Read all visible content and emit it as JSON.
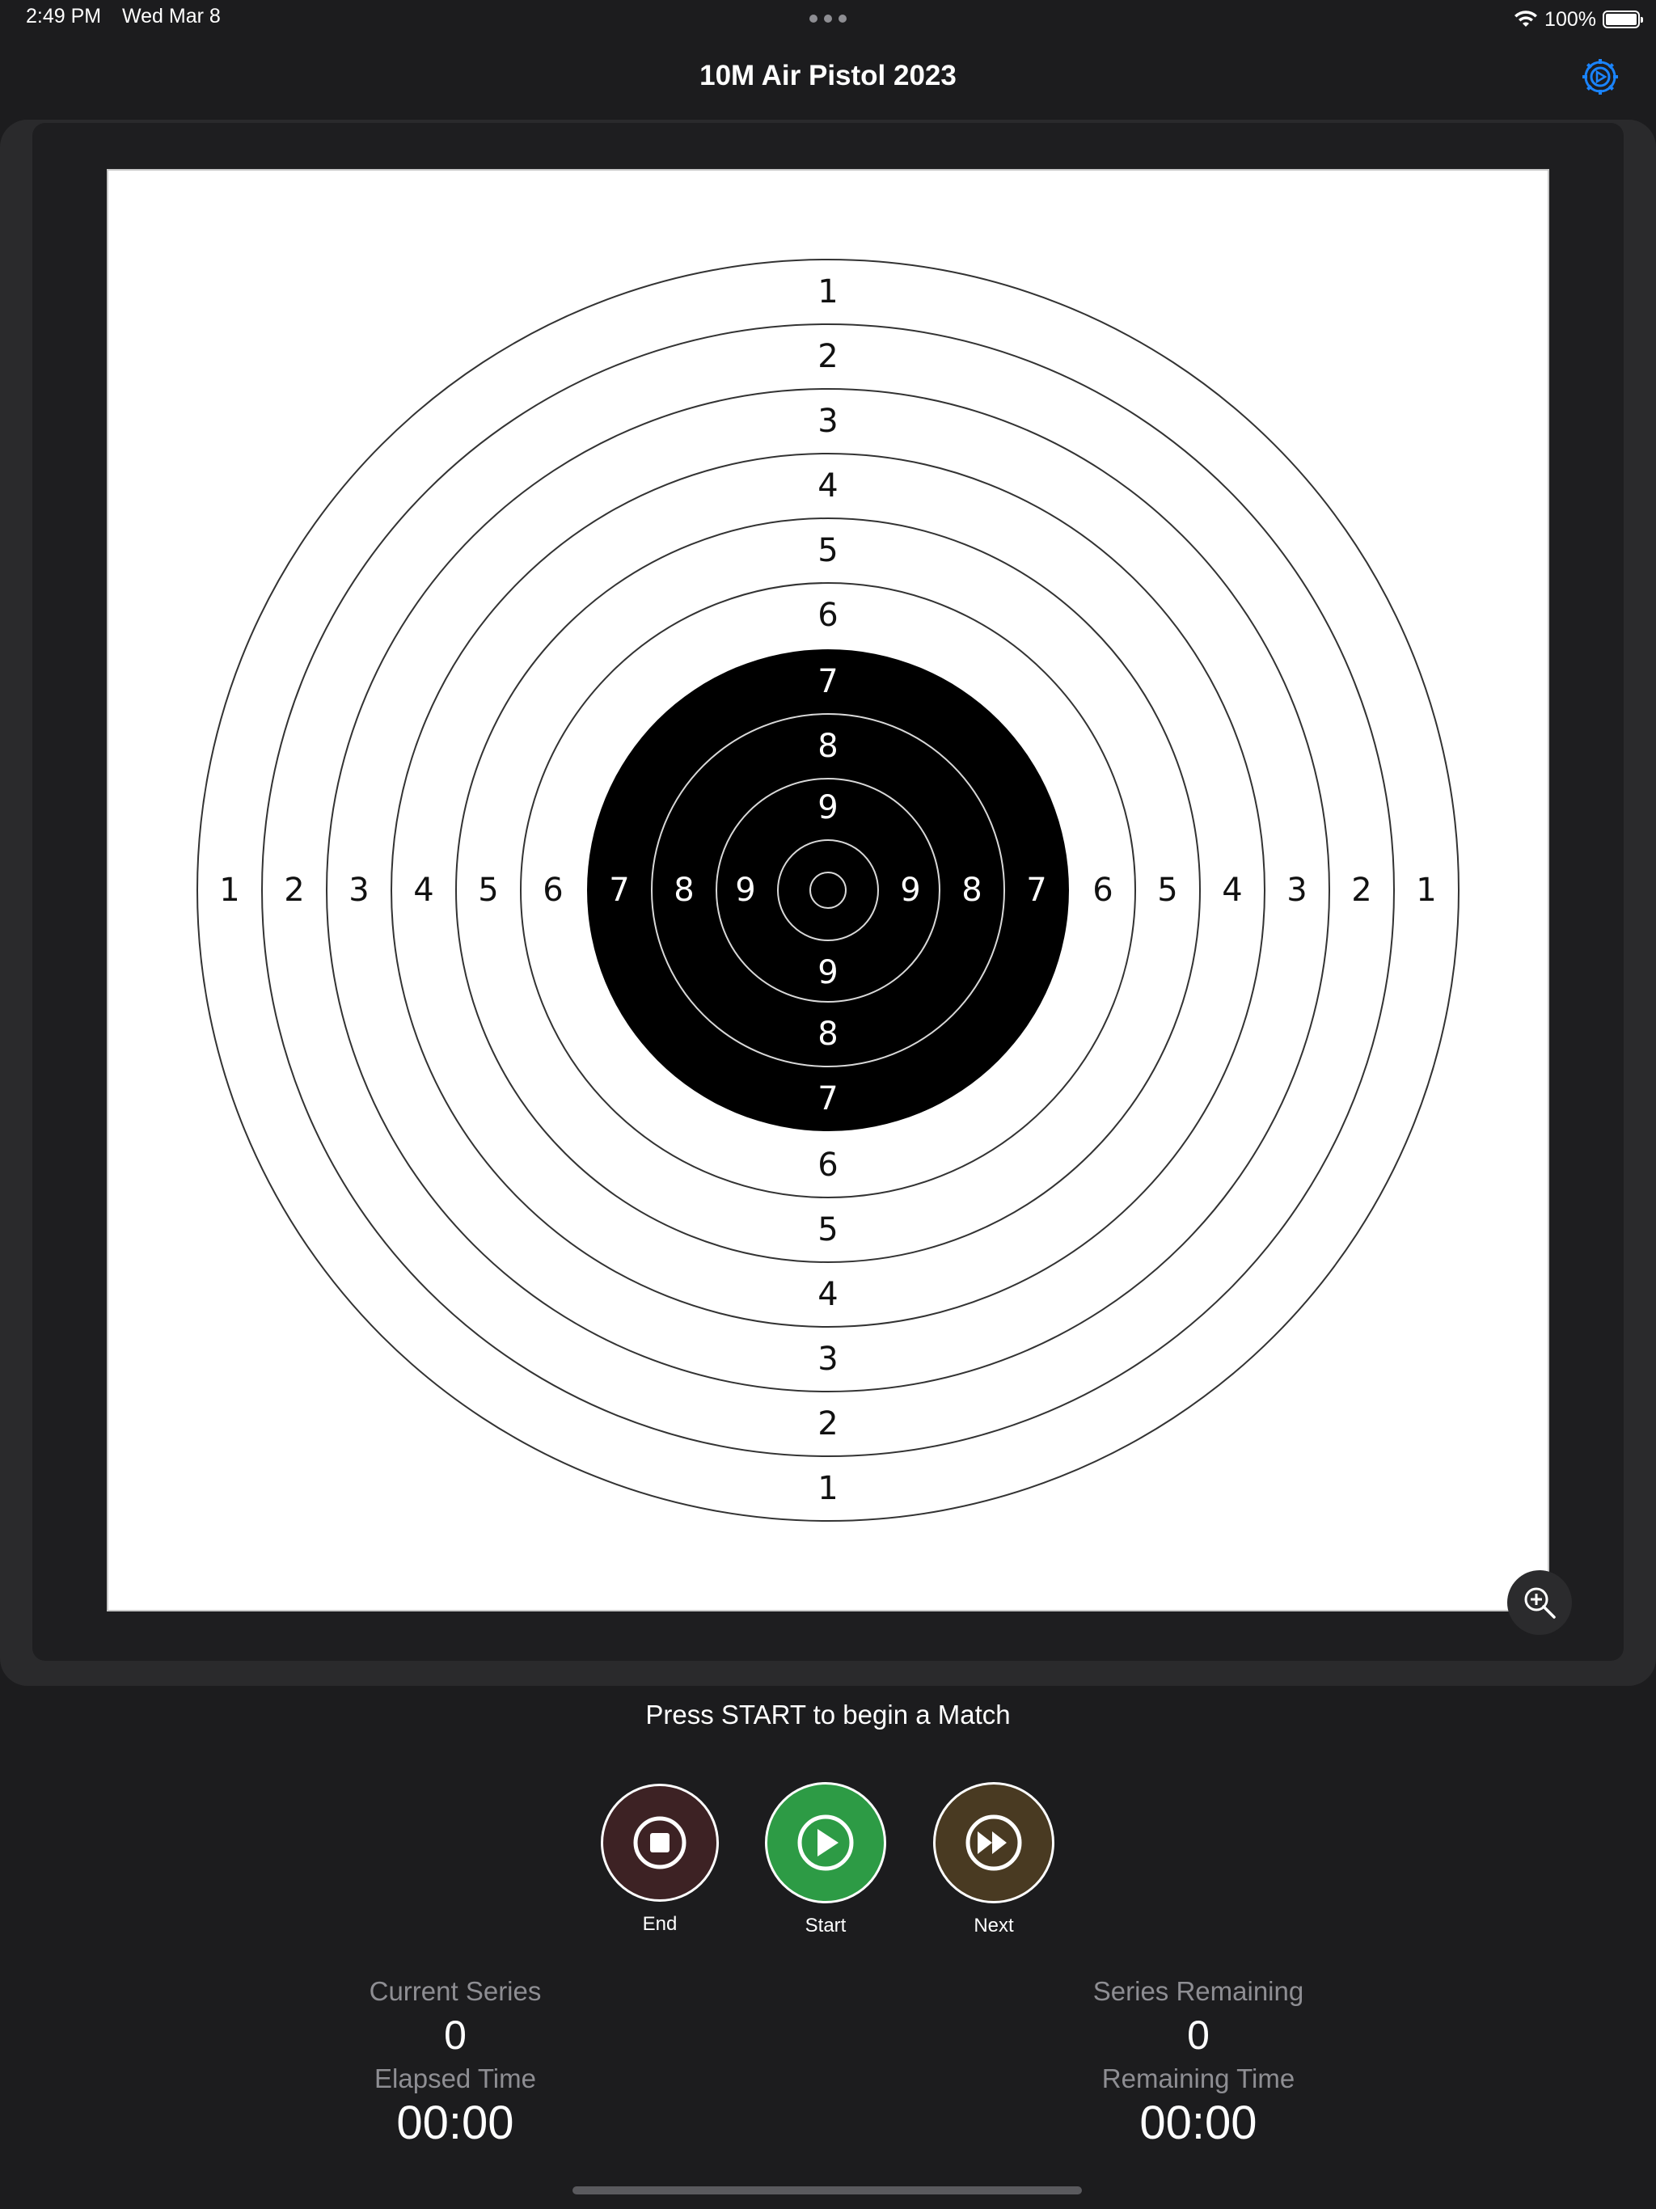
{
  "status_bar": {
    "time": "2:49 PM",
    "date": "Wed Mar 8",
    "battery": "100%"
  },
  "nav": {
    "title": "10M Air Pistol 2023",
    "settings_icon": "gear-icon",
    "accent_color": "#1a84ff"
  },
  "target": {
    "ring_labels_outer": [
      "1",
      "2",
      "3",
      "4",
      "5",
      "6"
    ],
    "ring_labels_black": [
      "7",
      "8",
      "9"
    ],
    "zoom_icon": "zoom-in-icon"
  },
  "prompt": "Press START to begin a Match",
  "controls": {
    "end": {
      "label": "End",
      "icon": "stop-icon",
      "color": "#3d2224"
    },
    "start": {
      "label": "Start",
      "icon": "play-icon",
      "color": "#2d9b45"
    },
    "next": {
      "label": "Next",
      "icon": "fast-forward-icon",
      "color": "#493a22"
    }
  },
  "stats": {
    "current_series": {
      "label": "Current Series",
      "value": "0"
    },
    "series_remaining": {
      "label": "Series Remaining",
      "value": "0"
    },
    "elapsed_time": {
      "label": "Elapsed Time",
      "value": "00:00"
    },
    "remaining_time": {
      "label": "Remaining Time",
      "value": "00:00"
    }
  }
}
